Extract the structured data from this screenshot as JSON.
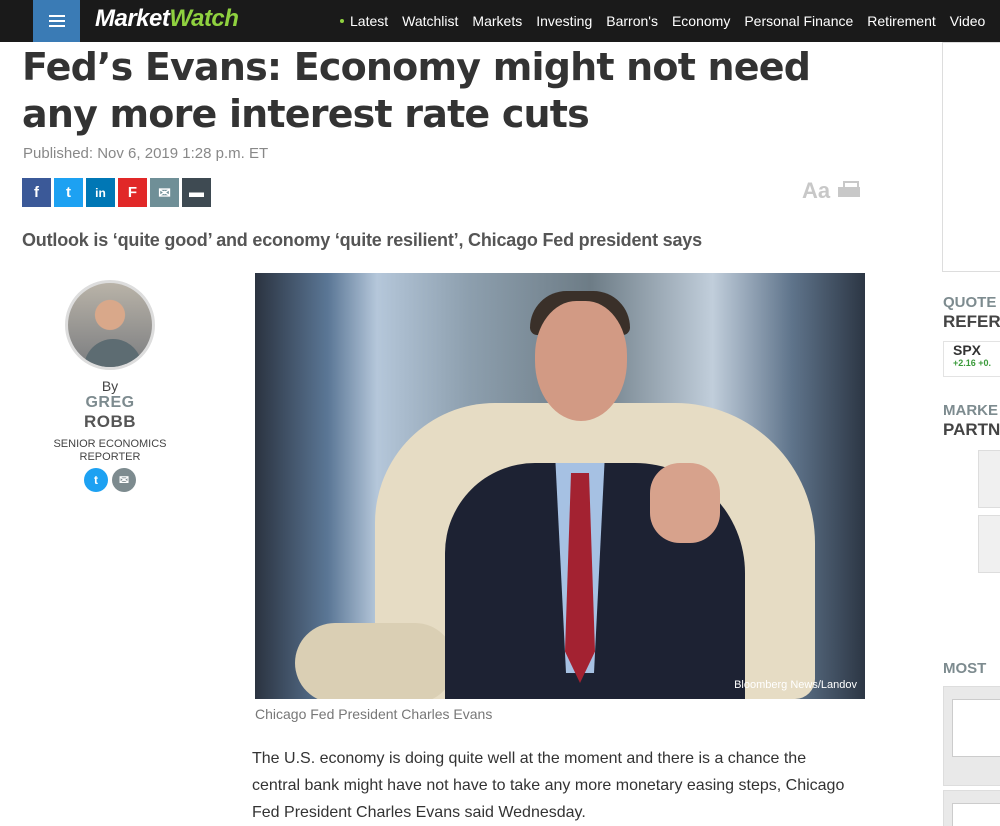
{
  "header": {
    "logo_part1": "Market",
    "logo_part2": "Watch",
    "nav": [
      "Latest",
      "Watchlist",
      "Markets",
      "Investing",
      "Barron's",
      "Economy",
      "Personal Finance",
      "Retirement",
      "Video"
    ]
  },
  "article": {
    "headline": "Fed’s Evans: Economy might not need any more interest rate cuts",
    "published": "Published: Nov 6, 2019 1:28 p.m. ET",
    "subhead": "Outlook is ‘quite good’ and economy ‘quite resilient’, Chicago Fed president says",
    "font_size_label": "Aa",
    "share_icons": [
      "facebook-icon",
      "twitter-icon",
      "linkedin-icon",
      "flipboard-icon",
      "email-icon",
      "comment-icon"
    ],
    "author": {
      "by": "By",
      "first": "GREG",
      "last": "ROBB",
      "role": "SENIOR ECONOMICS REPORTER"
    },
    "photo_credit": "Bloomberg News/Landov",
    "caption": "Chicago Fed President Charles Evans",
    "body": "The U.S. economy is doing quite well at the moment and there is a chance the central bank might have not have to take any more monetary easing steps, Chicago Fed President Charles Evans said Wednesday."
  },
  "rail": {
    "quote_label": "QUOTE",
    "reference_label": "REFER",
    "ticker_symbol": "SPX",
    "ticker_change": "+2.16 +0.",
    "market_label": "MARKE",
    "partner_label": "PARTN",
    "most_label": "MOST"
  },
  "colors": {
    "topbar": "#1a1a1a",
    "menu_blue": "#3a7bb5",
    "brand_green": "#8fd13f"
  }
}
